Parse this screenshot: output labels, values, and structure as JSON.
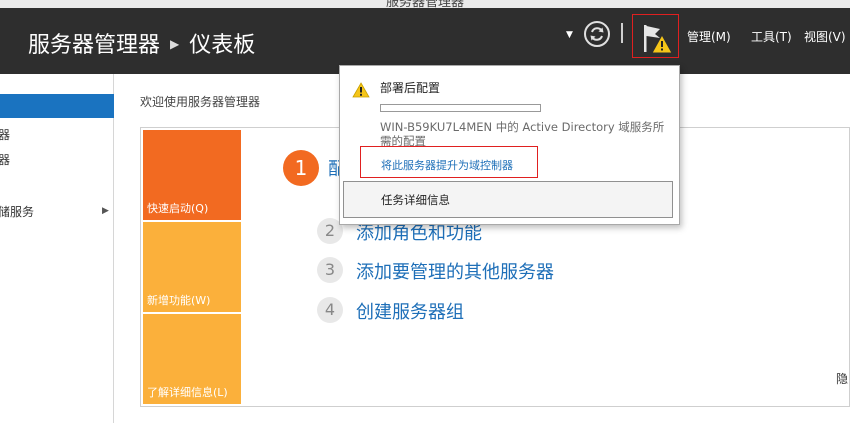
{
  "window": {
    "title": "服务器管理器"
  },
  "header": {
    "breadcrumb_app": "服务器管理器",
    "breadcrumb_page": "仪表板",
    "menus": {
      "manage": "管理(M)",
      "tools": "工具(T)",
      "view": "视图(V)"
    },
    "icons": {
      "dropdown": "chevron-down-icon",
      "refresh": "refresh-icon",
      "notifications": "flag-warning-icon"
    }
  },
  "sidebar": {
    "items": [
      {
        "label": ""
      },
      {
        "label": "器"
      },
      {
        "label": "器"
      },
      {
        "label": "储服务"
      }
    ]
  },
  "main": {
    "heading": "欢迎使用服务器管理器",
    "tiles": [
      {
        "label": "快速启动(Q)"
      },
      {
        "label": "新增功能(W)"
      },
      {
        "label": "了解详细信息(L)"
      }
    ],
    "steps": [
      {
        "num": "1",
        "label": "配置此本地服务器"
      },
      {
        "num": "2",
        "label": "添加角色和功能"
      },
      {
        "num": "3",
        "label": "添加要管理的其他服务器"
      },
      {
        "num": "4",
        "label": "创建服务器组"
      }
    ],
    "right_edge": "隐"
  },
  "notification": {
    "title": "部署后配置",
    "progress": 0,
    "description": "WIN-B59KU7L4MEN 中的 Active Directory 域服务所需的配置",
    "action_link": "将此服务器提升为域控制器",
    "details": "任务详细信息"
  },
  "colors": {
    "header_bg": "#2e2e2e",
    "accent_orange": "#f26a21",
    "tile_yellow": "#fbb03b",
    "link_blue": "#1e6fb8",
    "selection_blue": "#1a73c0",
    "warning_yellow": "#f5c518"
  }
}
